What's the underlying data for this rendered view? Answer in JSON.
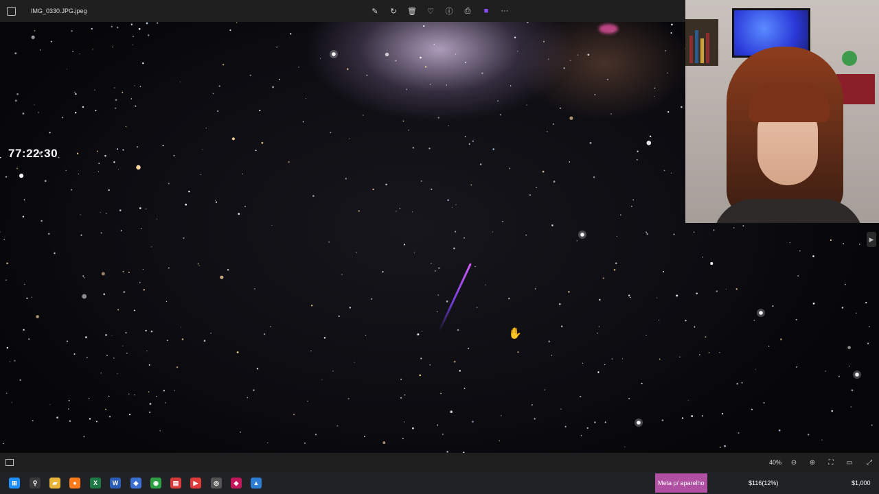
{
  "window": {
    "filename": "IMG_0330.JPG.jpeg"
  },
  "toolbar": {
    "items": [
      {
        "name": "edit-icon",
        "glyph": "✎"
      },
      {
        "name": "rotate-icon",
        "glyph": "↻"
      },
      {
        "name": "delete-icon",
        "glyph": "🗑"
      },
      {
        "name": "favorite-icon",
        "glyph": "♡"
      },
      {
        "name": "info-icon",
        "glyph": "ⓘ"
      },
      {
        "name": "print-icon",
        "glyph": "⎙"
      },
      {
        "name": "clipchamp-icon",
        "glyph": "■"
      },
      {
        "name": "more-icon",
        "glyph": "···"
      }
    ]
  },
  "overlay": {
    "timer": "77:22:30"
  },
  "statusbar": {
    "zoom": "40%",
    "buttons": [
      {
        "name": "zoom-out-icon",
        "glyph": "⊖"
      },
      {
        "name": "zoom-in-icon",
        "glyph": "⊕"
      },
      {
        "name": "fit-icon",
        "glyph": "⛶"
      },
      {
        "name": "actual-size-icon",
        "glyph": "▭"
      },
      {
        "name": "fullscreen-icon",
        "glyph": "⤢"
      }
    ]
  },
  "taskbar": {
    "apps": [
      {
        "name": "start-icon",
        "glyph": "⊞",
        "color": "#1e90ff"
      },
      {
        "name": "search-icon",
        "glyph": "⚲",
        "color": "#3a3a3a"
      },
      {
        "name": "file-explorer-icon",
        "glyph": "▰",
        "color": "#e8b43a"
      },
      {
        "name": "firefox-icon",
        "glyph": "●",
        "color": "#ff7a1a"
      },
      {
        "name": "excel-icon",
        "glyph": "X",
        "color": "#1d7a45"
      },
      {
        "name": "word-icon",
        "glyph": "W",
        "color": "#2b5cb8"
      },
      {
        "name": "stack-icon",
        "glyph": "◆",
        "color": "#3b6fd1"
      },
      {
        "name": "chrome-icon",
        "glyph": "◉",
        "color": "#2ea043"
      },
      {
        "name": "media-icon",
        "glyph": "▤",
        "color": "#d83b3b"
      },
      {
        "name": "player-icon",
        "glyph": "▶",
        "color": "#e03a3a"
      },
      {
        "name": "app-icon",
        "glyph": "◎",
        "color": "#555555"
      },
      {
        "name": "app2-icon",
        "glyph": "◈",
        "color": "#c2185b"
      },
      {
        "name": "photos-icon",
        "glyph": "▲",
        "color": "#2d7dd2"
      }
    ],
    "badge": "Meta p/ aparelho",
    "progress_text": "$116(12%)",
    "goal_text": "$1,000"
  }
}
